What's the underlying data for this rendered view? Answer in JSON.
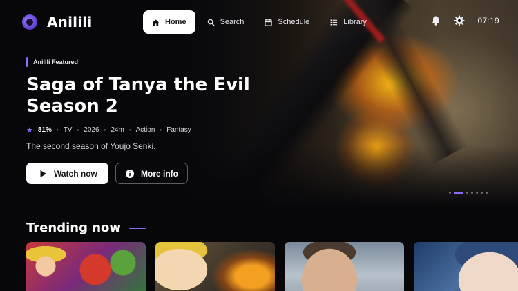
{
  "app": {
    "name": "Anilili"
  },
  "nav": {
    "items": [
      {
        "label": "Home",
        "icon": "home-icon",
        "active": true
      },
      {
        "label": "Search",
        "icon": "search-icon",
        "active": false
      },
      {
        "label": "Schedule",
        "icon": "calendar-icon",
        "active": false
      },
      {
        "label": "Library",
        "icon": "list-icon",
        "active": false
      }
    ]
  },
  "status": {
    "time": "07:19"
  },
  "hero": {
    "tag": "Anilili Featured",
    "title": "Saga of Tanya the Evil Season 2",
    "score": "81%",
    "meta": [
      "TV",
      "2026",
      "24m",
      "Action",
      "Fantasy"
    ],
    "description": "The second season of Youjo Senki.",
    "watch_label": "Watch now",
    "info_label": "More info",
    "carousel": {
      "count": 7,
      "active_index": 1
    }
  },
  "trending": {
    "title": "Trending now",
    "cards": [
      {
        "caption": ""
      },
      {
        "caption": ""
      },
      {
        "caption": ""
      },
      {
        "caption": ""
      }
    ]
  },
  "colors": {
    "accent": "#8b6cff",
    "background": "#07070a"
  }
}
